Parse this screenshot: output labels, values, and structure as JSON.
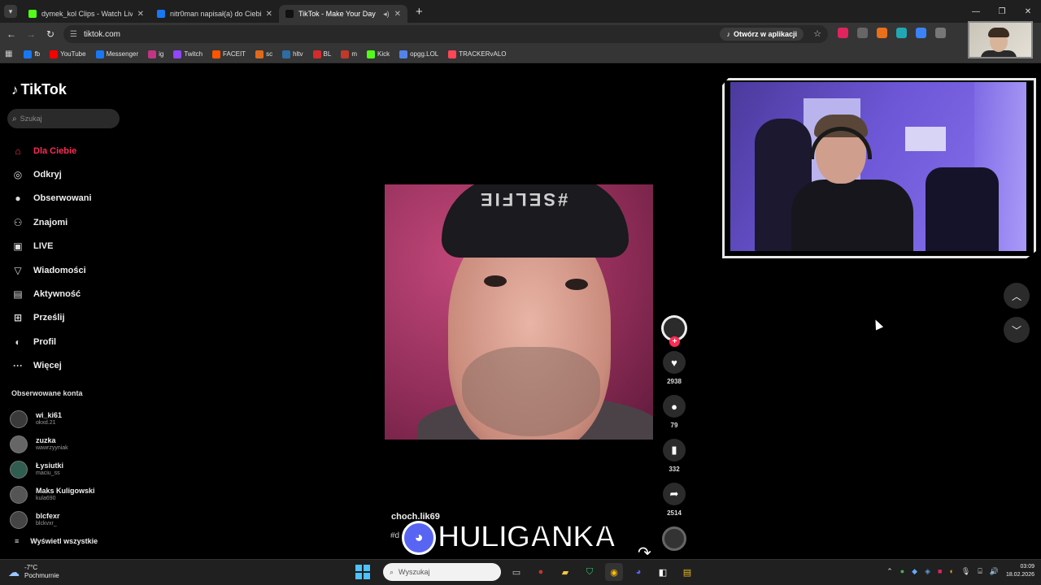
{
  "browser": {
    "tabs": [
      {
        "label": "dymek_kol Clips - Watch Live o",
        "color": "#53fc18",
        "active": false
      },
      {
        "label": "nitr0man napisał(a) do Ciebie",
        "color": "#1877f2",
        "active": false
      },
      {
        "label": "TikTok - Make Your Day",
        "color": "#111111",
        "active": true
      }
    ],
    "new_tab": "+",
    "url": "tiktok.com",
    "open_app": "Otwórz w aplikacji",
    "bookmarks": [
      {
        "label": "fb",
        "color": "#1877f2"
      },
      {
        "label": "YouTube",
        "color": "#ff0000"
      },
      {
        "label": "Messenger",
        "color": "#1877f2"
      },
      {
        "label": "ig",
        "color": "#c13584"
      },
      {
        "label": "Twitch",
        "color": "#9146ff"
      },
      {
        "label": "FACEIT",
        "color": "#ff5500"
      },
      {
        "label": "sc",
        "color": "#e06a1b"
      },
      {
        "label": "hltv",
        "color": "#2d6da3"
      },
      {
        "label": "BL",
        "color": "#d52b2b"
      },
      {
        "label": "m",
        "color": "#c0392b"
      },
      {
        "label": "Kick",
        "color": "#53fc18"
      },
      {
        "label": "opgg.LOL",
        "color": "#5383e8"
      },
      {
        "label": "TRACKERvALO",
        "color": "#ff4655"
      }
    ]
  },
  "tiktok": {
    "logo": "TikTok",
    "search_placeholder": "Szukaj",
    "nav": [
      {
        "label": "Dla Ciebie",
        "icon": "home-icon",
        "glyph": "⌂",
        "active": true
      },
      {
        "label": "Odkryj",
        "icon": "compass-icon",
        "glyph": "◎",
        "active": false
      },
      {
        "label": "Obserwowani",
        "icon": "following-avatar-icon",
        "glyph": "●",
        "active": false
      },
      {
        "label": "Znajomi",
        "icon": "friends-icon",
        "glyph": "⚇",
        "active": false
      },
      {
        "label": "LIVE",
        "icon": "live-icon",
        "glyph": "▣",
        "active": false
      },
      {
        "label": "Wiadomości",
        "icon": "messages-icon",
        "glyph": "▽",
        "active": false
      },
      {
        "label": "Aktywność",
        "icon": "activity-icon",
        "glyph": "▤",
        "active": false
      },
      {
        "label": "Prześlij",
        "icon": "upload-icon",
        "glyph": "⊞",
        "active": false
      },
      {
        "label": "Profil",
        "icon": "profile-icon",
        "glyph": "◐",
        "active": false
      },
      {
        "label": "Więcej",
        "icon": "more-icon",
        "glyph": "···",
        "active": false
      }
    ],
    "following_header": "Obserwowane konta",
    "following": [
      {
        "name": "wi_ki61",
        "handle": "okxd.21"
      },
      {
        "name": "zuzka",
        "handle": "wawrzyyniak"
      },
      {
        "name": "Łysiutki",
        "handle": "maciu_ss"
      },
      {
        "name": "Maks Kuligowski",
        "handle": "kula690"
      },
      {
        "name": "blcfexr",
        "handle": "blckvxr_"
      }
    ],
    "see_all": "Wyświetl wszystkie",
    "video": {
      "beanie_text": "#SELFIE",
      "author": "choch.lik69",
      "caption": "#d",
      "likes": "2938",
      "comments": "79",
      "saves": "332",
      "shares": "2514"
    }
  },
  "overlay": {
    "text": "HULIGANKA"
  },
  "taskbar": {
    "temperature": "-7°C",
    "weather": "Pochmurnie",
    "search_placeholder": "Wyszukaj",
    "time": "03:09",
    "date": "18.02.2026"
  }
}
